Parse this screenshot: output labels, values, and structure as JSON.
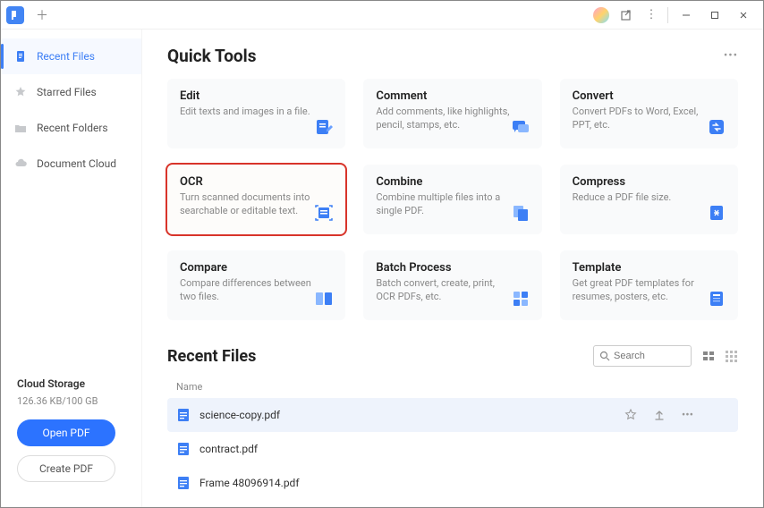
{
  "sidebar": {
    "items": [
      {
        "label": "Recent Files"
      },
      {
        "label": "Starred Files"
      },
      {
        "label": "Recent Folders"
      },
      {
        "label": "Document Cloud"
      }
    ],
    "storage": {
      "title": "Cloud Storage",
      "sub": "126.36 KB/100 GB",
      "open_label": "Open PDF",
      "create_label": "Create PDF"
    }
  },
  "quick_tools": {
    "title": "Quick Tools",
    "cards": [
      {
        "title": "Edit",
        "desc": "Edit texts and images in a file."
      },
      {
        "title": "Comment",
        "desc": "Add comments, like highlights, pencil, stamps, etc."
      },
      {
        "title": "Convert",
        "desc": "Convert PDFs to Word, Excel, PPT, etc."
      },
      {
        "title": "OCR",
        "desc": "Turn scanned documents into searchable or editable text."
      },
      {
        "title": "Combine",
        "desc": "Combine multiple files into a single PDF."
      },
      {
        "title": "Compress",
        "desc": "Reduce a PDF file size."
      },
      {
        "title": "Compare",
        "desc": "Compare differences between two files."
      },
      {
        "title": "Batch Process",
        "desc": "Batch convert, create, print, OCR PDFs, etc."
      },
      {
        "title": "Template",
        "desc": "Get great PDF templates for resumes, posters, etc."
      }
    ]
  },
  "recent_files": {
    "title": "Recent Files",
    "column": "Name",
    "search_placeholder": "Search",
    "rows": [
      {
        "name": "science-copy.pdf"
      },
      {
        "name": "contract.pdf"
      },
      {
        "name": "Frame 48096914.pdf"
      }
    ]
  }
}
